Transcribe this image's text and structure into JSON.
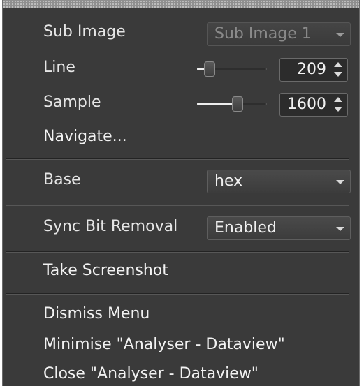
{
  "menu": {
    "sub_image": {
      "label": "Sub Image",
      "value": "Sub Image 1",
      "enabled": false
    },
    "line": {
      "label": "Line",
      "value": "209",
      "slider_fraction": 0.12
    },
    "sample": {
      "label": "Sample",
      "value": "1600",
      "slider_fraction": 0.6
    },
    "navigate": {
      "label": "Navigate..."
    },
    "base": {
      "label": "Base",
      "value": "hex"
    },
    "sync_bit_removal": {
      "label": "Sync Bit Removal",
      "value": "Enabled"
    },
    "take_screenshot": {
      "label": "Take Screenshot"
    },
    "dismiss_menu": {
      "label": "Dismiss Menu"
    },
    "minimise": {
      "label": "Minimise \"Analyser - Dataview\""
    },
    "close": {
      "label": "Close \"Analyser - Dataview\""
    }
  },
  "colors": {
    "menu_bg": "#3a3a3a",
    "text": "#e6e6e6",
    "disabled_text": "#8a8a8a"
  },
  "icons": [
    "chevron-down-icon",
    "spin-up-icon",
    "spin-down-icon",
    "slider-handle"
  ]
}
